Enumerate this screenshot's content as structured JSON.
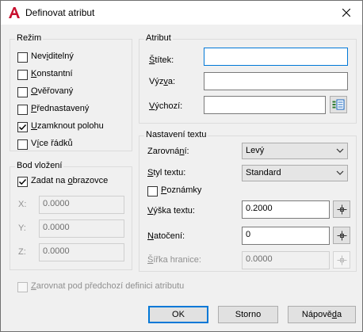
{
  "window": {
    "title": "Definovat atribut"
  },
  "mode": {
    "title": "Režim",
    "items": [
      {
        "label": "Neviditelný",
        "checked": false
      },
      {
        "label": "Konstantní",
        "checked": false
      },
      {
        "label": "Ověřovaný",
        "checked": false
      },
      {
        "label": "Přednastavený",
        "checked": false
      },
      {
        "label": "Uzamknout polohu",
        "checked": true
      },
      {
        "label": "Více řádků",
        "checked": false
      }
    ]
  },
  "insertion": {
    "title": "Bod vložení",
    "on_screen_label": "Zadat na obrazovce",
    "on_screen_checked": true,
    "x_label": "X:",
    "x_value": "0.0000",
    "y_label": "Y:",
    "y_value": "0.0000",
    "z_label": "Z:",
    "z_value": "0.0000"
  },
  "attribute": {
    "title": "Atribut",
    "tag_label": "Štítek:",
    "tag_value": "",
    "prompt_label": "Výzva:",
    "prompt_value": "",
    "default_label": "Výchozí:",
    "default_value": ""
  },
  "text_settings": {
    "title": "Nastavení textu",
    "justification_label": "Zarovnání:",
    "justification_value": "Levý",
    "style_label": "Styl textu:",
    "style_value": "Standard",
    "annotative_label": "Poznámky",
    "annotative_checked": false,
    "height_label": "Výška textu:",
    "height_value": "0.2000",
    "rotation_label": "Natočení:",
    "rotation_value": "0",
    "width_label": "Šířka hranice:",
    "width_value": "0.0000"
  },
  "align_below": {
    "label": "Zarovnat pod předchozí definici atributu",
    "checked": false
  },
  "buttons": {
    "ok": "OK",
    "cancel": "Storno",
    "help": "Nápověda"
  },
  "colors": {
    "accent": "#0078d7",
    "app_icon": "#c8102e"
  }
}
